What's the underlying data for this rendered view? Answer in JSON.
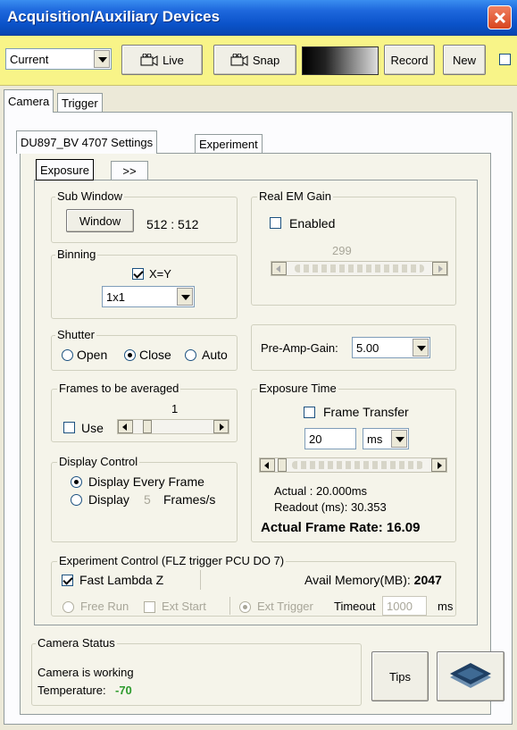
{
  "window": {
    "title": "Acquisition/Auxiliary Devices"
  },
  "toolbar": {
    "mode_value": "Current",
    "live_label": "Live",
    "snap_label": "Snap",
    "record_label": "Record",
    "new_label": "New"
  },
  "main_tabs": [
    "Camera",
    "Trigger"
  ],
  "camera_tabs": [
    "DU897_BV 4707 Settings",
    "Experiment"
  ],
  "sub_tabs": [
    "Exposure",
    ">>"
  ],
  "sub_window": {
    "label": "Sub Window",
    "button": "Window",
    "value": "512 : 512"
  },
  "binning": {
    "label": "Binning",
    "xy_label": "X=Y",
    "value": "1x1"
  },
  "shutter": {
    "label": "Shutter",
    "options": [
      "Open",
      "Close",
      "Auto"
    ],
    "selected": "Close"
  },
  "real_em_gain": {
    "label": "Real EM Gain",
    "enabled_label": "Enabled",
    "value": "299"
  },
  "pre_amp": {
    "label": "Pre-Amp-Gain:",
    "value": "5.00"
  },
  "frames_avg": {
    "label": "Frames to be averaged",
    "value": "1",
    "use_label": "Use"
  },
  "exposure_time": {
    "label": "Exposure Time",
    "frame_transfer_label": "Frame Transfer",
    "value": "20",
    "unit": "ms",
    "actual": "Actual :  20.000ms",
    "readout": "Readout (ms): 30.353",
    "frame_rate": "Actual Frame Rate: 16.09"
  },
  "display_control": {
    "label": "Display Control",
    "option1": "Display Every Frame",
    "option2_prefix": "Display",
    "option2_value": "5",
    "option2_suffix": "Frames/s"
  },
  "experiment_control": {
    "label": "Experiment Control (FLZ trigger PCU DO 7)",
    "fast_lambda_label": "Fast Lambda Z",
    "avail_mem_label": "Avail Memory(MB):",
    "avail_mem_value": "2047",
    "free_run": "Free Run",
    "ext_start": "Ext Start",
    "ext_trigger": "Ext Trigger",
    "timeout_label": "Timeout",
    "timeout_value": "1000",
    "timeout_unit": "ms"
  },
  "camera_status": {
    "label": "Camera Status",
    "status": "Camera is working",
    "temp_label": "Temperature:",
    "temp_value": "-70"
  },
  "tips_label": "Tips",
  "colors": {
    "titlebar": "#0a52c9",
    "toolbar": "#f8f488",
    "temperature": "#2e9b2e"
  }
}
